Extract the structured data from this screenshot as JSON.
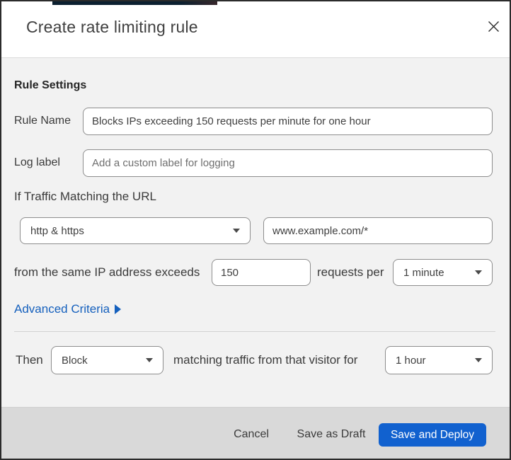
{
  "modal": {
    "title": "Create rate limiting rule"
  },
  "form": {
    "section_heading": "Rule Settings",
    "rule_name": {
      "label": "Rule Name",
      "value": "Blocks IPs exceeding 150 requests per minute for one hour"
    },
    "log_label": {
      "label": "Log label",
      "placeholder": "Add a custom label for logging"
    },
    "traffic_match": {
      "heading": "If Traffic Matching the URL",
      "scheme_selected": "http & https",
      "url_value": "www.example.com/*",
      "threshold_prefix": "from the same IP address exceeds",
      "threshold_value": "150",
      "threshold_suffix": "requests per",
      "period_selected": "1 minute"
    },
    "advanced_criteria_label": "Advanced Criteria",
    "then": {
      "label": "Then",
      "action_selected": "Block",
      "middle_text": "matching traffic from that visitor for",
      "duration_selected": "1 hour"
    }
  },
  "footer": {
    "cancel_label": "Cancel",
    "save_draft_label": "Save as Draft",
    "save_deploy_label": "Save and Deploy"
  },
  "colors": {
    "primary_blue": "#1161cf",
    "link_blue": "#1560bd",
    "body_bg": "#f2f2f2",
    "footer_bg": "#d9d9d9",
    "top_strip": "#0c2030"
  }
}
